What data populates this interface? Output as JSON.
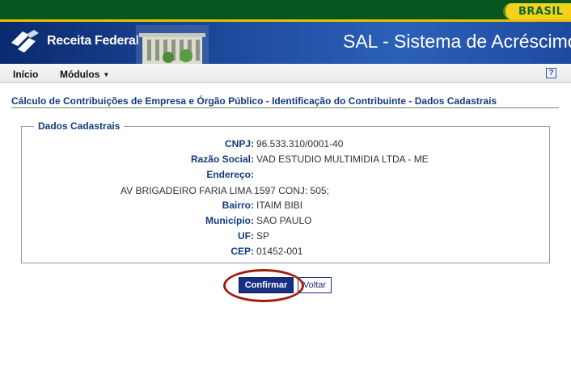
{
  "header": {
    "brasil_label": "BRASIL",
    "logo_text": "Receita Federal",
    "app_title": "SAL - Sistema de Acréscimos L"
  },
  "menu": {
    "items": [
      {
        "label": "Início"
      },
      {
        "label": "Módulos"
      }
    ],
    "help_label": "?"
  },
  "page": {
    "heading": "Cálculo de Contribuições de Empresa e Órgão Público - Identificação do Contribuinte - Dados Cadastrais"
  },
  "dados": {
    "legend": "Dados Cadastrais",
    "cnpj": {
      "label": "CNPJ:",
      "value": "96.533.310/0001-40"
    },
    "razao_social": {
      "label": "Razão Social:",
      "value": "VAD ESTUDIO MULTIMIDIA LTDA - ME"
    },
    "endereco": {
      "label": "Endereço:",
      "value": "AV BRIGADEIRO FARIA LIMA 1597 CONJ: 505;"
    },
    "bairro": {
      "label": "Bairro:",
      "value": "ITAIM BIBI"
    },
    "municipio": {
      "label": "Município:",
      "value": "SAO PAULO"
    },
    "uf": {
      "label": "UF:",
      "value": "SP"
    },
    "cep": {
      "label": "CEP:",
      "value": "01452-001"
    }
  },
  "actions": {
    "confirm_label": "Confirmar",
    "back_label": "Voltar"
  },
  "colors": {
    "gov_green": "#07561f",
    "brasil_yellow": "#f4d21c",
    "banner_blue": "#1d4a9c",
    "label_blue": "#123a7d",
    "button_blue": "#172f84",
    "highlight_red": "#a31d0f"
  }
}
